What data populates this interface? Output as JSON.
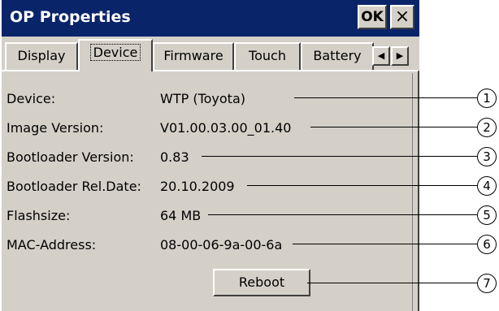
{
  "window": {
    "title": "OP Properties",
    "ok_label": "OK",
    "close_label": "×"
  },
  "tabs": [
    {
      "label": "Display",
      "active": false
    },
    {
      "label": "Device",
      "active": true
    },
    {
      "label": "Firmware",
      "active": false
    },
    {
      "label": "Touch",
      "active": false
    },
    {
      "label": "Battery",
      "active": false
    }
  ],
  "tab_scroll": {
    "left_icon": "◀",
    "right_icon": "▶"
  },
  "fields": [
    {
      "label": "Device:",
      "value": "WTP (Toyota)"
    },
    {
      "label": "Image Version:",
      "value": "V01.00.03.00_01.40"
    },
    {
      "label": "Bootloader Version:",
      "value": "0.83"
    },
    {
      "label": "Bootloader Rel.Date:",
      "value": "20.10.2009"
    },
    {
      "label": "Flashsize:",
      "value": "64 MB"
    },
    {
      "label": "MAC-Address:",
      "value": "08-00-06-9a-00-6a"
    }
  ],
  "reboot_label": "Reboot",
  "callouts": [
    "1",
    "2",
    "3",
    "4",
    "5",
    "6",
    "7"
  ]
}
